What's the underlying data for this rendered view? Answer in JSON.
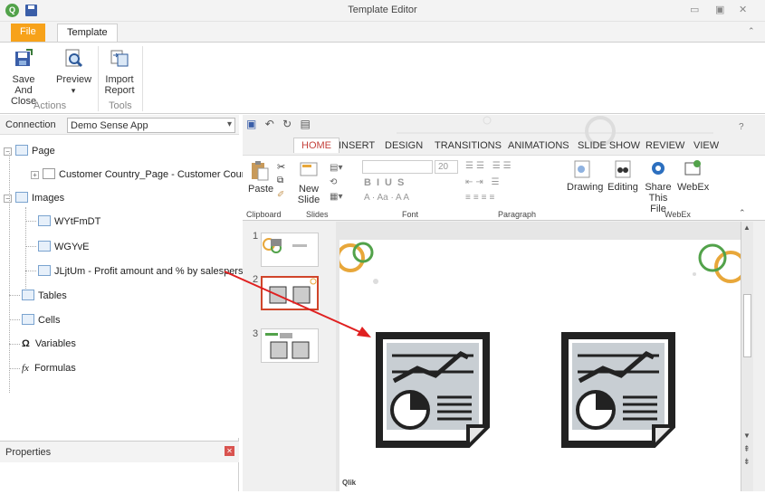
{
  "window": {
    "title": "Template Editor",
    "app_icon": "Q"
  },
  "tabs": {
    "file": "File",
    "template": "Template"
  },
  "ribbon": {
    "save_close": "Save And Close",
    "preview": "Preview",
    "import_report": "Import Report",
    "group_actions": "Actions",
    "group_tools": "Tools"
  },
  "connection": {
    "label": "Connection",
    "value": "Demo Sense App"
  },
  "tree": {
    "page": "Page",
    "customer_country": "Customer Country_Page - Customer Country",
    "images": "Images",
    "img1": "WYtFmDT",
    "img2": "WGYvE",
    "img3": "JLjtUm - Profit amount and % by salesperson",
    "tables": "Tables",
    "cells": "Cells",
    "variables": "Variables",
    "formulas": "Formulas"
  },
  "properties": {
    "label": "Properties"
  },
  "ppt": {
    "tabs": [
      "HOME",
      "INSERT",
      "DESIGN",
      "TRANSITIONS",
      "ANIMATIONS",
      "SLIDE SHOW",
      "REVIEW",
      "VIEW"
    ],
    "paste": "Paste",
    "new_slide": "New Slide",
    "font_size": "20",
    "drawing": "Drawing",
    "editing": "Editing",
    "share": "Share This File",
    "webex": "WebEx",
    "groups": {
      "clipboard": "Clipboard",
      "slides": "Slides",
      "font": "Font",
      "paragraph": "Paragraph",
      "webex": "WebEx"
    },
    "slide_numbers": [
      "1",
      "2",
      "3"
    ],
    "footer_brand": "Qlik"
  },
  "colors": {
    "accent_file": "#f7a21a",
    "home_tab": "#c4413b",
    "arrow": "#e02020",
    "qlik_green": "#52a24a"
  }
}
